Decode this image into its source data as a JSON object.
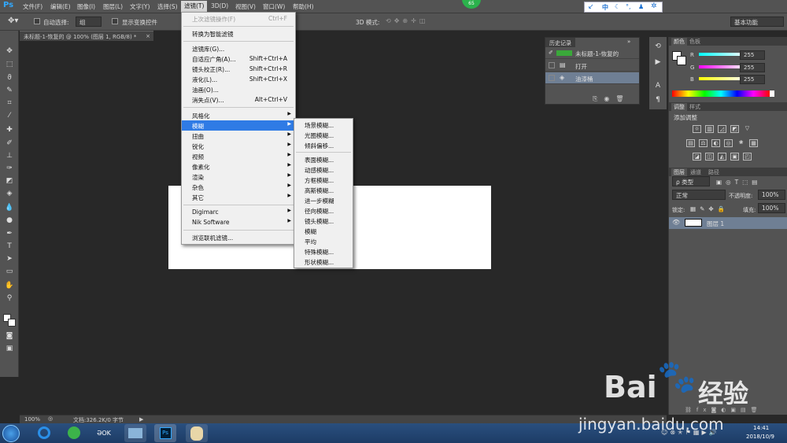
{
  "app": {
    "logo": "Ps",
    "badge": "65"
  },
  "menubar": [
    "文件(F)",
    "编辑(E)",
    "图像(I)",
    "图层(L)",
    "文字(Y)",
    "选择(S)",
    "滤镜(T)",
    "3D(D)",
    "视图(V)",
    "窗口(W)",
    "帮助(H)"
  ],
  "ime": {
    "lang": "中"
  },
  "options": {
    "auto_select": "自动选择:",
    "group": "组",
    "show_transform": "显示变换控件",
    "mode3d": "3D 模式:",
    "workspace": "基本功能"
  },
  "document": {
    "tab": "未标题-1-恢复的 @ 100% (图层 1, RGB/8) *",
    "tab_close": "×",
    "zoom": "100%",
    "info": "文档:326.2K/0 字节"
  },
  "filter_menu": {
    "last": {
      "label": "上次滤镜操作(F)",
      "shortcut": "Ctrl+F"
    },
    "smart": "转换为智能滤镜",
    "items1": [
      {
        "label": "滤镜库(G)...",
        "shortcut": ""
      },
      {
        "label": "自适应广角(A)...",
        "shortcut": "Shift+Ctrl+A"
      },
      {
        "label": "镜头校正(R)...",
        "shortcut": "Shift+Ctrl+R"
      },
      {
        "label": "液化(L)...",
        "shortcut": "Shift+Ctrl+X"
      },
      {
        "label": "油画(O)...",
        "shortcut": ""
      },
      {
        "label": "消失点(V)...",
        "shortcut": "Alt+Ctrl+V"
      }
    ],
    "items2": [
      "风格化",
      "模糊",
      "扭曲",
      "锐化",
      "视频",
      "像素化",
      "渲染",
      "杂色",
      "其它"
    ],
    "items3": [
      "Digimarc",
      "Nik Software"
    ],
    "browse": "浏览联机滤镜..."
  },
  "blur_submenu": {
    "group1": [
      "场景模糊...",
      "光圈模糊...",
      "倾斜偏移..."
    ],
    "group2": [
      "表面模糊...",
      "动感模糊...",
      "方框模糊...",
      "高斯模糊...",
      "进一步模糊",
      "径向模糊...",
      "镜头模糊...",
      "模糊",
      "平均",
      "特殊模糊...",
      "形状模糊..."
    ]
  },
  "history": {
    "title": "历史记录",
    "doc": "未标题-1-恢复的",
    "rows": [
      "打开",
      "油漆桶"
    ]
  },
  "color": {
    "tabs": [
      "颜色",
      "色板"
    ],
    "r": "255",
    "g": "255",
    "b": "255",
    "labels": [
      "R",
      "G",
      "B"
    ]
  },
  "adjust": {
    "tabs": [
      "调整",
      "样式"
    ],
    "title": "添加调整"
  },
  "layers": {
    "tabs": [
      "图层",
      "通道",
      "路径"
    ],
    "filter": "ρ 类型",
    "blend": "正常",
    "opacity_label": "不透明度:",
    "opacity": "100%",
    "lock_label": "锁定:",
    "fill_label": "填充:",
    "fill": "100%",
    "layer_name": "图层 1"
  },
  "taskbar": {
    "time": "14:41",
    "date": "2018/10/9"
  },
  "watermark": {
    "brand": "Bai",
    "brand2": "经验",
    "url": "jingyan.baidu.com"
  }
}
